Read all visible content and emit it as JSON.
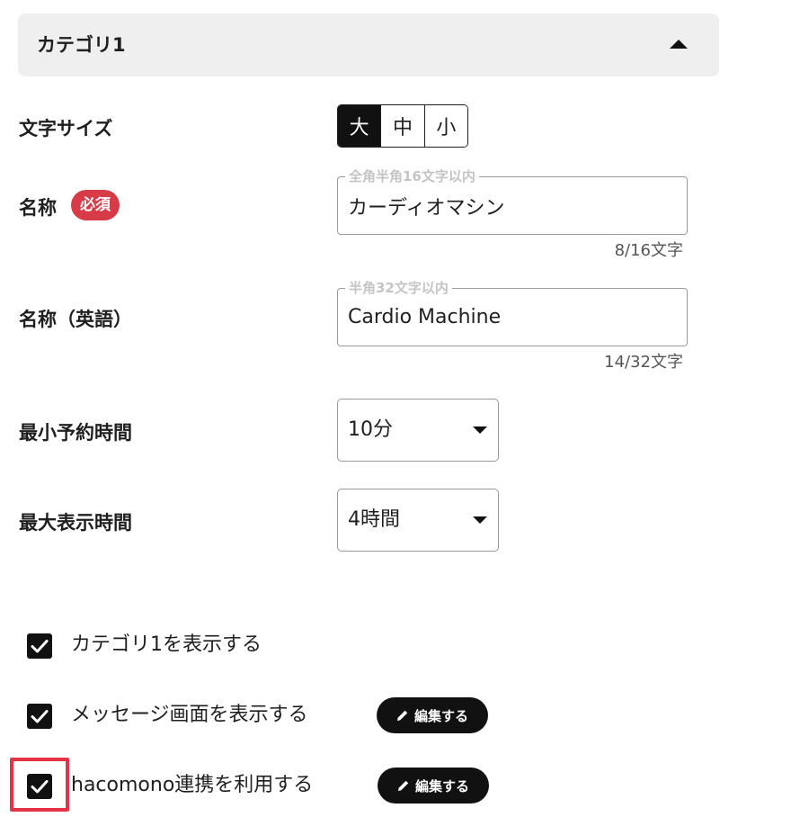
{
  "category": {
    "title": "カテゴリ1"
  },
  "text_size": {
    "label": "文字サイズ",
    "options": [
      "大",
      "中",
      "小"
    ],
    "selected": "大"
  },
  "name": {
    "label": "名称",
    "required_badge": "必須",
    "legend": "全角半角16文字以内",
    "value": "カーディオマシン",
    "counter": "8/16文字"
  },
  "name_en": {
    "label": "名称（英語）",
    "legend": "半角32文字以内",
    "value": "Cardio Machine",
    "counter": "14/32文字"
  },
  "min_booking_time": {
    "label": "最小予約時間",
    "value": "10分"
  },
  "max_display_time": {
    "label": "最大表示時間",
    "value": "4時間"
  },
  "checks": [
    {
      "label": "カテゴリ1を表示する",
      "checked": true
    },
    {
      "label": "メッセージ画面を表示する",
      "checked": true,
      "edit_label": "編集する"
    },
    {
      "label": "hacomono連携を利用する",
      "checked": true,
      "edit_label": "編集する"
    }
  ],
  "icons": {
    "accordion": "caret-up-icon",
    "select": "caret-down-icon",
    "checkbox": "checkmark-icon",
    "edit": "pencil-icon"
  },
  "colors": {
    "accent_dark": "#111111",
    "required_badge": "#d63b47",
    "highlight": "#e63246"
  }
}
